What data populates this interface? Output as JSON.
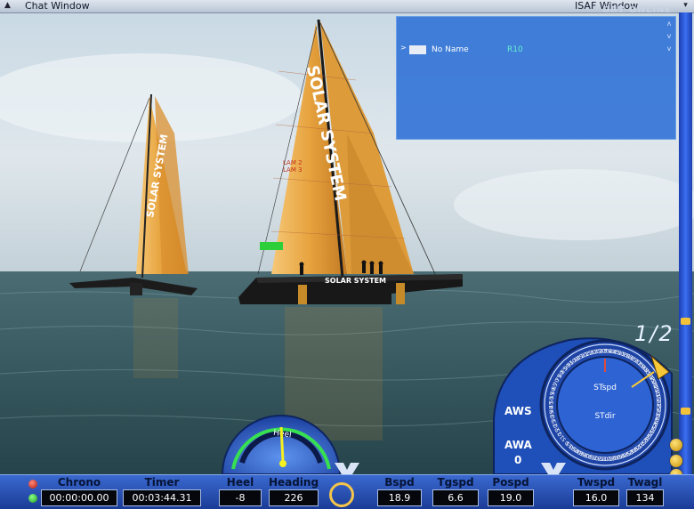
{
  "window": {
    "chat_title": "Chat Window",
    "isaf_title": "ISAF Window",
    "watermark": "GRY ONLINE"
  },
  "isaf_panel": {
    "rows": [
      {
        "name": "No Name",
        "sail": "R10"
      }
    ]
  },
  "hud": {
    "race_position": "1/2",
    "heel_gauge_label": "Heel",
    "wind_labels": {
      "aws": "AWS",
      "awa": "AWA",
      "awa_value": "0"
    },
    "compass": {
      "inner_top": "STspd",
      "inner_bottom": "STdir",
      "ticks": [
        "0",
        "5",
        "10",
        "15",
        "20",
        "25",
        "30",
        "35",
        "40",
        "45",
        "50",
        "55",
        "60",
        "65",
        "70",
        "75",
        "80",
        "85",
        "90",
        "95",
        "100",
        "105",
        "110",
        "115",
        "120",
        "125",
        "130",
        "135",
        "140",
        "145",
        "150",
        "155",
        "160",
        "165",
        "170",
        "175",
        "180",
        "185",
        "190",
        "195",
        "200",
        "205",
        "210",
        "215",
        "220",
        "225",
        "230",
        "235",
        "240",
        "245",
        "250",
        "255",
        "260",
        "265",
        "270",
        "275",
        "280",
        "285",
        "290",
        "295",
        "300",
        "305",
        "310",
        "315",
        "320",
        "325",
        "330",
        "335",
        "340",
        "345",
        "350",
        "355"
      ]
    }
  },
  "bottom_bar": {
    "chrono": {
      "label": "Chrono",
      "value": "00:00:00.00"
    },
    "timer": {
      "label": "Timer",
      "value": "00:03:44.31"
    },
    "heel": {
      "label": "Heel",
      "value": "-8"
    },
    "heading": {
      "label": "Heading",
      "value": "226"
    },
    "bspd": {
      "label": "Bspd",
      "value": "18.9"
    },
    "tgspd": {
      "label": "Tgspd",
      "value": "6.6"
    },
    "pospd": {
      "label": "Pospd",
      "value": "19.0"
    },
    "twspd": {
      "label": "Twspd",
      "value": "16.0"
    },
    "twa": {
      "label": "Twagl",
      "value": "134"
    }
  },
  "boats": {
    "brand": "SOLAR SYSTEM",
    "sail_mark_1": "LAM 2",
    "sail_mark_2": "LAM 3"
  },
  "colors": {
    "sky": "#bcd0de",
    "sea": "#36535b",
    "sail": "#e8a03a",
    "hud_blue": "#2a5ac8"
  }
}
